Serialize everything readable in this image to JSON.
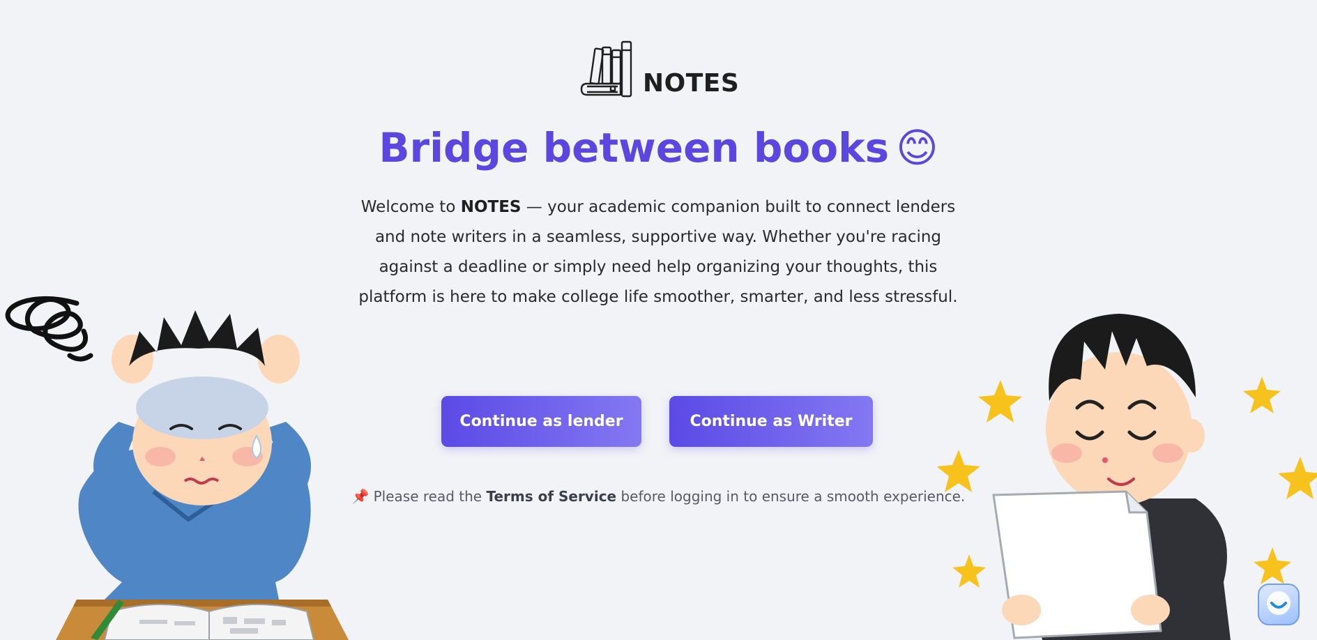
{
  "brand": {
    "name": "NOTES",
    "logo_icon": "books-icon"
  },
  "hero": {
    "title": "Bridge between books",
    "title_emoji": "😊",
    "intro": {
      "prefix": "Welcome to ",
      "brand": "NOTES",
      "suffix": " — your academic companion built to connect lenders and note writers in a seamless, supportive way. Whether you're racing against a deadline or simply need help organizing your thoughts, this platform is here to make college life smoother, smarter, and less stressful."
    }
  },
  "actions": {
    "lender_label": "Continue as lender",
    "writer_label": "Continue as Writer"
  },
  "notice": {
    "pin_icon": "📌",
    "prefix": "Please read the ",
    "link": "Terms of Service",
    "suffix": " before logging in to ensure a smooth experience."
  },
  "chat_widget": {
    "icon": "chat-smile-icon"
  },
  "colors": {
    "accent": "#5b47e0",
    "button_start": "#5b4ae6",
    "button_end": "#8478f2",
    "background": "#f2f3f7"
  }
}
